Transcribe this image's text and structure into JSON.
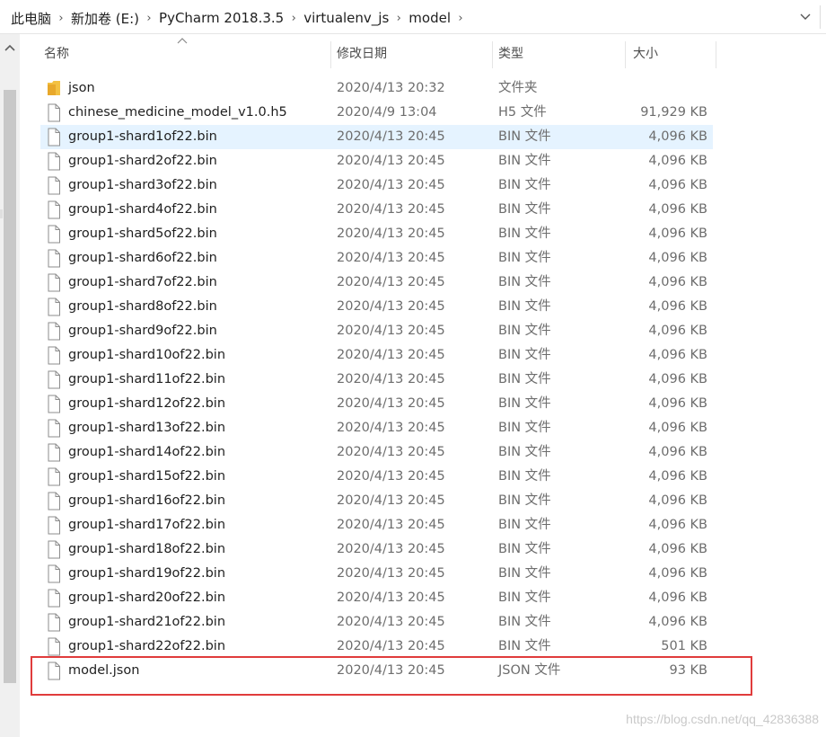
{
  "breadcrumb": {
    "items": [
      "此电脑",
      "新加卷 (E:)",
      "PyCharm 2018.3.5",
      "virtualenv_js",
      "model"
    ]
  },
  "columns": {
    "name": "名称",
    "date": "修改日期",
    "type": "类型",
    "size": "大小"
  },
  "files": [
    {
      "name": "json",
      "date": "2020/4/13 20:32",
      "type": "文件夹",
      "size": "",
      "kind": "folder-icon"
    },
    {
      "name": "chinese_medicine_model_v1.0.h5",
      "date": "2020/4/9 13:04",
      "type": "H5 文件",
      "size": "91,929 KB",
      "kind": "file-icon"
    },
    {
      "name": "group1-shard1of22.bin",
      "date": "2020/4/13 20:45",
      "type": "BIN 文件",
      "size": "4,096 KB",
      "kind": "file-icon",
      "selected": true
    },
    {
      "name": "group1-shard2of22.bin",
      "date": "2020/4/13 20:45",
      "type": "BIN 文件",
      "size": "4,096 KB",
      "kind": "file-icon"
    },
    {
      "name": "group1-shard3of22.bin",
      "date": "2020/4/13 20:45",
      "type": "BIN 文件",
      "size": "4,096 KB",
      "kind": "file-icon"
    },
    {
      "name": "group1-shard4of22.bin",
      "date": "2020/4/13 20:45",
      "type": "BIN 文件",
      "size": "4,096 KB",
      "kind": "file-icon"
    },
    {
      "name": "group1-shard5of22.bin",
      "date": "2020/4/13 20:45",
      "type": "BIN 文件",
      "size": "4,096 KB",
      "kind": "file-icon"
    },
    {
      "name": "group1-shard6of22.bin",
      "date": "2020/4/13 20:45",
      "type": "BIN 文件",
      "size": "4,096 KB",
      "kind": "file-icon"
    },
    {
      "name": "group1-shard7of22.bin",
      "date": "2020/4/13 20:45",
      "type": "BIN 文件",
      "size": "4,096 KB",
      "kind": "file-icon"
    },
    {
      "name": "group1-shard8of22.bin",
      "date": "2020/4/13 20:45",
      "type": "BIN 文件",
      "size": "4,096 KB",
      "kind": "file-icon"
    },
    {
      "name": "group1-shard9of22.bin",
      "date": "2020/4/13 20:45",
      "type": "BIN 文件",
      "size": "4,096 KB",
      "kind": "file-icon"
    },
    {
      "name": "group1-shard10of22.bin",
      "date": "2020/4/13 20:45",
      "type": "BIN 文件",
      "size": "4,096 KB",
      "kind": "file-icon"
    },
    {
      "name": "group1-shard11of22.bin",
      "date": "2020/4/13 20:45",
      "type": "BIN 文件",
      "size": "4,096 KB",
      "kind": "file-icon"
    },
    {
      "name": "group1-shard12of22.bin",
      "date": "2020/4/13 20:45",
      "type": "BIN 文件",
      "size": "4,096 KB",
      "kind": "file-icon"
    },
    {
      "name": "group1-shard13of22.bin",
      "date": "2020/4/13 20:45",
      "type": "BIN 文件",
      "size": "4,096 KB",
      "kind": "file-icon"
    },
    {
      "name": "group1-shard14of22.bin",
      "date": "2020/4/13 20:45",
      "type": "BIN 文件",
      "size": "4,096 KB",
      "kind": "file-icon"
    },
    {
      "name": "group1-shard15of22.bin",
      "date": "2020/4/13 20:45",
      "type": "BIN 文件",
      "size": "4,096 KB",
      "kind": "file-icon"
    },
    {
      "name": "group1-shard16of22.bin",
      "date": "2020/4/13 20:45",
      "type": "BIN 文件",
      "size": "4,096 KB",
      "kind": "file-icon"
    },
    {
      "name": "group1-shard17of22.bin",
      "date": "2020/4/13 20:45",
      "type": "BIN 文件",
      "size": "4,096 KB",
      "kind": "file-icon"
    },
    {
      "name": "group1-shard18of22.bin",
      "date": "2020/4/13 20:45",
      "type": "BIN 文件",
      "size": "4,096 KB",
      "kind": "file-icon"
    },
    {
      "name": "group1-shard19of22.bin",
      "date": "2020/4/13 20:45",
      "type": "BIN 文件",
      "size": "4,096 KB",
      "kind": "file-icon"
    },
    {
      "name": "group1-shard20of22.bin",
      "date": "2020/4/13 20:45",
      "type": "BIN 文件",
      "size": "4,096 KB",
      "kind": "file-icon"
    },
    {
      "name": "group1-shard21of22.bin",
      "date": "2020/4/13 20:45",
      "type": "BIN 文件",
      "size": "4,096 KB",
      "kind": "file-icon"
    },
    {
      "name": "group1-shard22of22.bin",
      "date": "2020/4/13 20:45",
      "type": "BIN 文件",
      "size": "501 KB",
      "kind": "file-icon"
    },
    {
      "name": "model.json",
      "date": "2020/4/13 20:45",
      "type": "JSON 文件",
      "size": "93 KB",
      "kind": "file-icon",
      "highlighted": true
    }
  ],
  "watermark": "https://blog.csdn.net/qq_42836388",
  "colors": {
    "selection": "#e5f3ff",
    "highlight_border": "#e03c3c",
    "folder": "#f3c142"
  }
}
